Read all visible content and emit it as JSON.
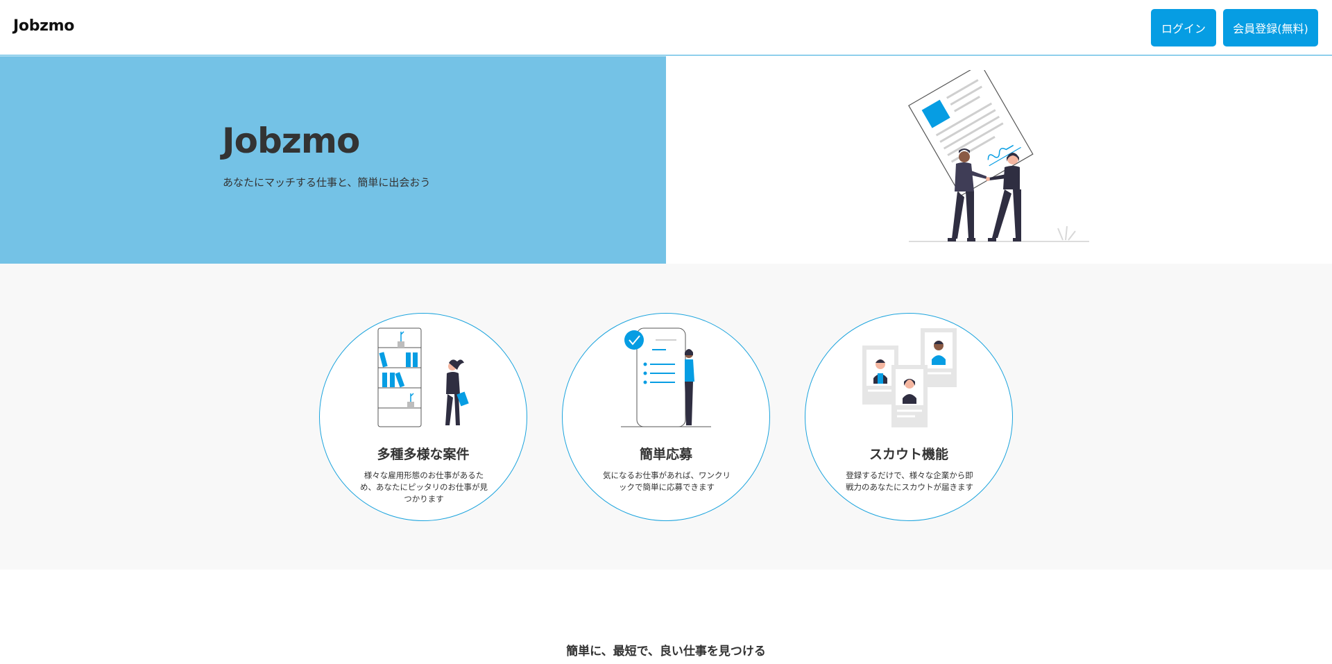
{
  "header": {
    "logo": "Jobzmo",
    "login_label": "ログイン",
    "register_label": "会員登録(無料)"
  },
  "hero": {
    "title": "Jobzmo",
    "subtitle": "あなたにマッチする仕事と、簡単に出会おう",
    "illustration_icon": "contract-handshake-illustration"
  },
  "features": [
    {
      "title": "多種多様な案件",
      "description": "様々な雇用形態のお仕事があるため、あなたにピッタリのお仕事が見つかります",
      "icon": "bookshelf-woman-illustration"
    },
    {
      "title": "簡単応募",
      "description": "気になるお仕事があれば、ワンクリックで簡単に応募できます",
      "icon": "phone-checklist-illustration"
    },
    {
      "title": "スカウト機能",
      "description": "登録するだけで、様々な企業から即戦力のあなたにスカウトが届きます",
      "icon": "profile-cards-illustration"
    }
  ],
  "section": {
    "heading": "簡単に、最短で、良い仕事を見つける"
  },
  "colors": {
    "accent": "#069de3",
    "hero_bg": "#74c2e6",
    "features_bg": "#f8f8f8",
    "circle_border": "#1aa3dd"
  }
}
